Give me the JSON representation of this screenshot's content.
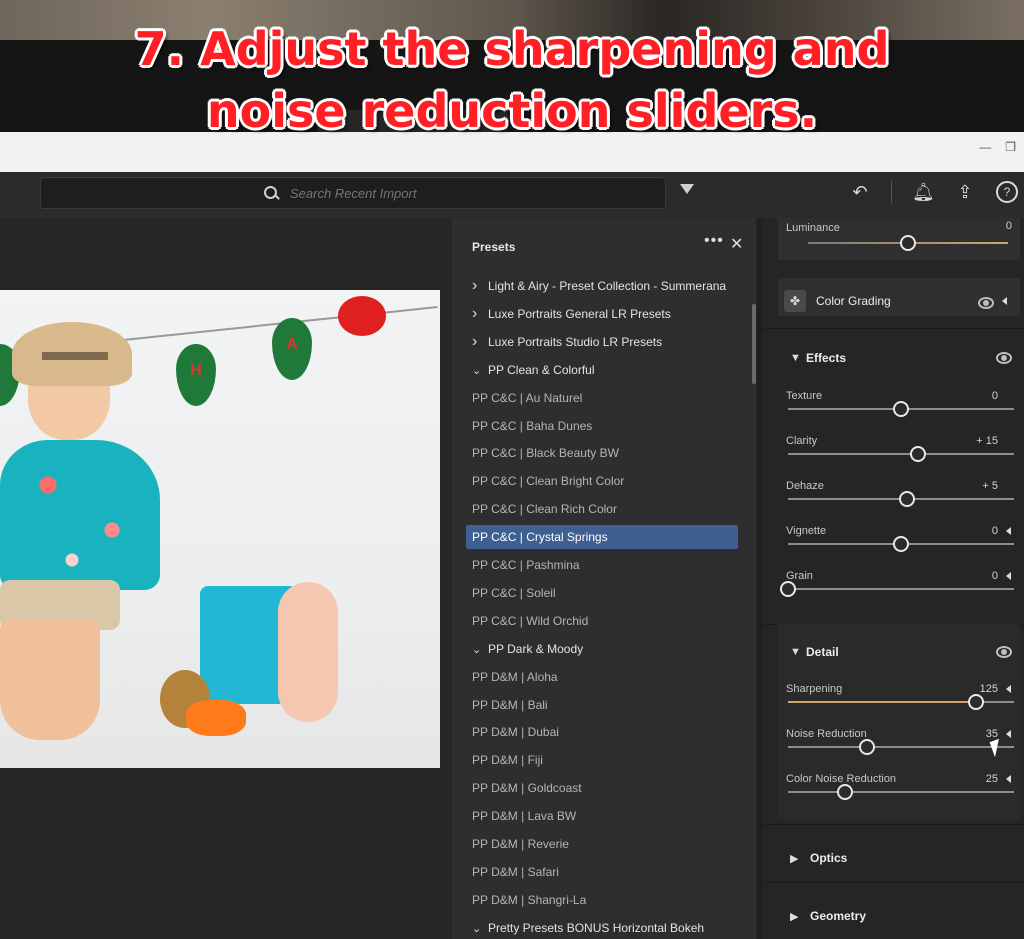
{
  "caption": {
    "line1": "7. Adjust the sharpening and",
    "line2": "noise reduction sliders."
  },
  "search": {
    "placeholder": "Search Recent Import"
  },
  "photo": {
    "banner_letters": [
      "H",
      "A"
    ]
  },
  "presets_panel": {
    "title": "Presets",
    "more_label": "•••",
    "close_label": "✕",
    "items": [
      {
        "label": "Light & Airy - Preset Collection - Summerana",
        "type": "folder",
        "expanded": false
      },
      {
        "label": "Luxe Portraits General LR Presets",
        "type": "folder",
        "expanded": false
      },
      {
        "label": "Luxe Portraits Studio LR Presets",
        "type": "folder",
        "expanded": false
      },
      {
        "label": "PP Clean & Colorful",
        "type": "folder",
        "expanded": true
      },
      {
        "label": "PP C&C | Au Naturel",
        "type": "preset"
      },
      {
        "label": "PP C&C | Baha Dunes",
        "type": "preset"
      },
      {
        "label": "PP C&C | Black Beauty BW",
        "type": "preset"
      },
      {
        "label": "PP C&C | Clean Bright Color",
        "type": "preset"
      },
      {
        "label": "PP C&C | Clean Rich Color",
        "type": "preset"
      },
      {
        "label": "PP C&C | Crystal Springs",
        "type": "preset",
        "selected": true
      },
      {
        "label": "PP C&C | Pashmina",
        "type": "preset"
      },
      {
        "label": "PP C&C | Soleil",
        "type": "preset"
      },
      {
        "label": "PP C&C | Wild Orchid",
        "type": "preset"
      },
      {
        "label": "PP Dark & Moody",
        "type": "folder",
        "expanded": true
      },
      {
        "label": "PP D&M | Aloha",
        "type": "preset"
      },
      {
        "label": "PP D&M | Bali",
        "type": "preset"
      },
      {
        "label": "PP D&M | Dubai",
        "type": "preset"
      },
      {
        "label": "PP D&M | Fiji",
        "type": "preset"
      },
      {
        "label": "PP D&M | Goldcoast",
        "type": "preset"
      },
      {
        "label": "PP D&M | Lava BW",
        "type": "preset"
      },
      {
        "label": "PP D&M | Reverie",
        "type": "preset"
      },
      {
        "label": "PP D&M | Safari",
        "type": "preset"
      },
      {
        "label": "PP D&M | Shangri-La",
        "type": "preset"
      },
      {
        "label": "Pretty Presets BONUS Horizontal Bokeh",
        "type": "folder",
        "expanded": true
      }
    ]
  },
  "edit_panel": {
    "luminance": {
      "label": "Luminance",
      "value": "0",
      "position": 0.5
    },
    "color_grading": {
      "title": "Color Grading"
    },
    "effects": {
      "title": "Effects",
      "sliders": [
        {
          "label": "Texture",
          "value": "0",
          "position": 0.5
        },
        {
          "label": "Clarity",
          "value": "+ 15",
          "position": 0.575
        },
        {
          "label": "Dehaze",
          "value": "+ 5",
          "position": 0.525
        },
        {
          "label": "Vignette",
          "value": "0",
          "position": 0.5
        },
        {
          "label": "Grain",
          "value": "0",
          "position": 0.0
        }
      ]
    },
    "detail": {
      "title": "Detail",
      "sliders": [
        {
          "label": "Sharpening",
          "value": "125",
          "position": 0.833
        },
        {
          "label": "Noise Reduction",
          "value": "35",
          "position": 0.35
        },
        {
          "label": "Color Noise Reduction",
          "value": "25",
          "position": 0.25
        }
      ]
    },
    "optics": {
      "title": "Optics"
    },
    "geometry": {
      "title": "Geometry"
    }
  },
  "colors": {
    "selected_row": "#3f5f91",
    "slider_fill": "#d2a56a",
    "caption_red": "#ff1f24"
  }
}
